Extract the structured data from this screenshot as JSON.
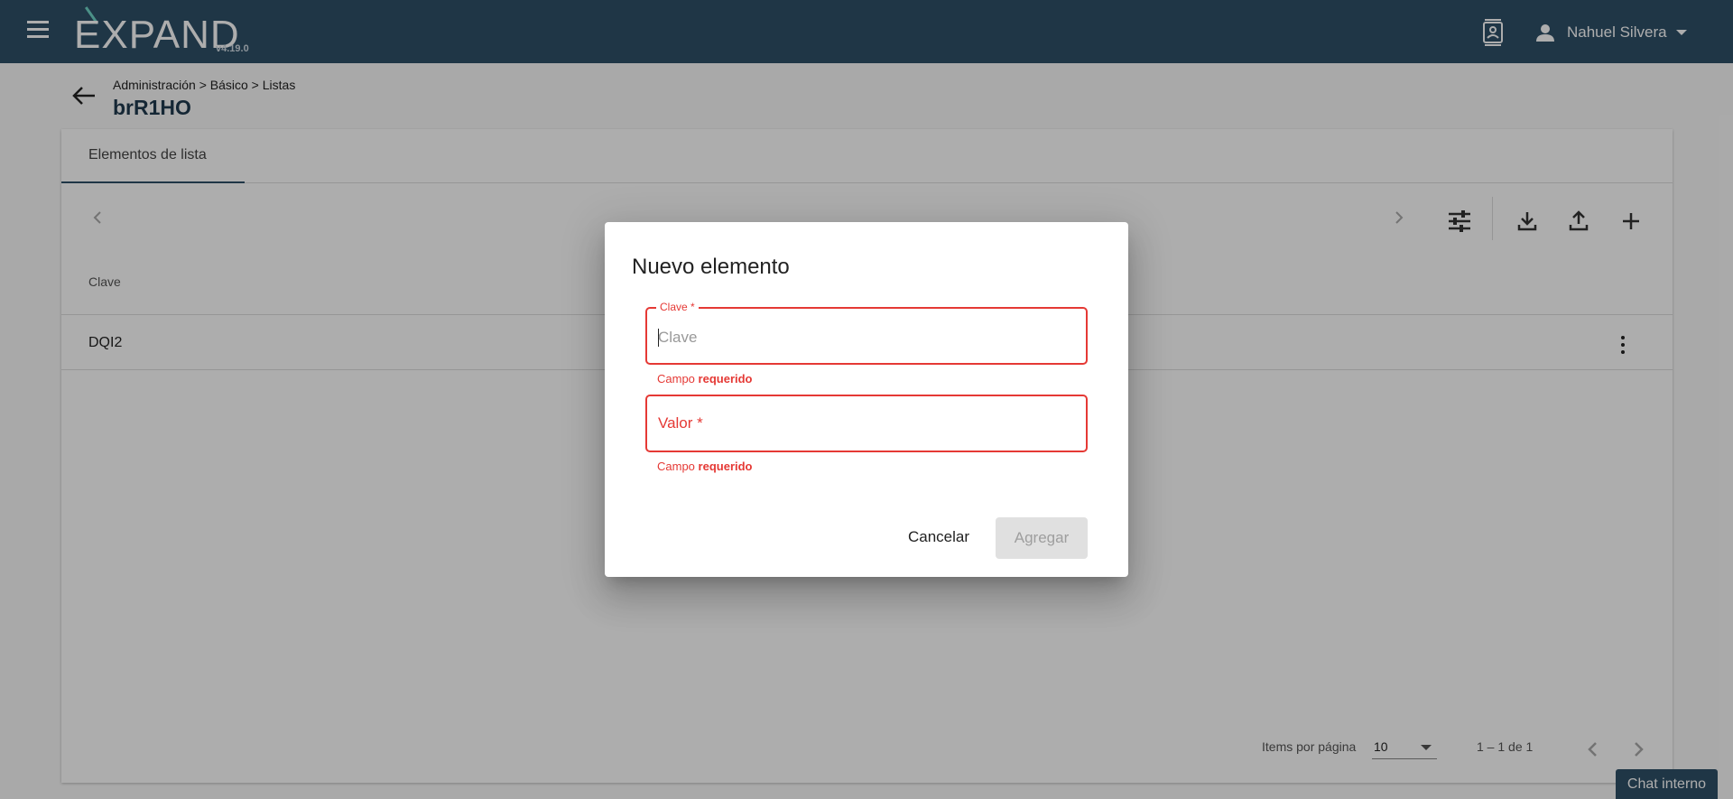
{
  "header": {
    "logo": "EXPAND",
    "version": "v4.19.0",
    "user_name": "Nahuel Silvera",
    "icons": {
      "menu": "menu-icon",
      "contact": "contact-card-icon",
      "user": "person-icon",
      "caret": "caret-down-icon"
    }
  },
  "breadcrumb": {
    "path": "Administración > Básico > Listas",
    "title": "brR1HO"
  },
  "card": {
    "tab_label": "Elementos de lista",
    "column_header": "Clave",
    "rows": [
      {
        "clave": "DQI2"
      }
    ],
    "toolbar_icons": [
      "tune-icon",
      "download-icon",
      "upload-icon",
      "add-icon"
    ]
  },
  "paginator": {
    "items_label": "Items por página",
    "page_size": "10",
    "range_label": "1 – 1 de 1"
  },
  "chat": {
    "label": "Chat interno"
  },
  "dialog": {
    "title": "Nuevo elemento",
    "clave": {
      "float_label": "Clave *",
      "placeholder": "Clave",
      "value": ""
    },
    "clave_error": {
      "prefix": "Campo",
      "bold": "requerido"
    },
    "valor": {
      "label": "Valor *",
      "value": ""
    },
    "valor_error": {
      "prefix": "Campo",
      "bold": "requerido"
    },
    "cancel_label": "Cancelar",
    "add_label": "Agregar"
  },
  "colors": {
    "header_bg": "#2f5068",
    "error": "#e53935",
    "disabled_bg": "#e0e0e0"
  }
}
